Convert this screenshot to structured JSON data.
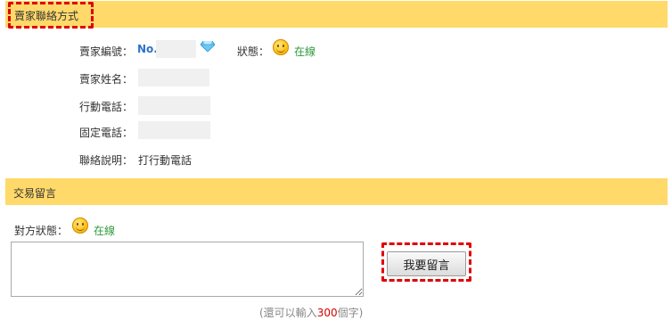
{
  "seller_section": {
    "title": "賣家聯絡方式",
    "seller_id_label": "賣家編號：",
    "seller_id_prefix": "No.",
    "status_label": "狀態：",
    "status_value": "在線",
    "name_label": "賣家姓名：",
    "mobile_label": "行動電話：",
    "phone_label": "固定電話：",
    "note_label": "聯絡說明：",
    "note_value": "打行動電話"
  },
  "message_section": {
    "title": "交易留言",
    "other_status_label": "對方狀態：",
    "other_status_value": "在線",
    "message_value": "",
    "submit_label": "我要留言",
    "hint_prefix": "(還可以輸入",
    "hint_count": "300",
    "hint_suffix": "個字)"
  },
  "colors": {
    "header_bg": "#ffd96a",
    "seller_id_color": "#2f73c8",
    "online_color": "#2e9b3e",
    "highlight_color": "#e00000",
    "count_color": "#d40000"
  },
  "icons": {
    "status_icon": "smiley-icon",
    "grade_icon": "diamond-icon"
  }
}
